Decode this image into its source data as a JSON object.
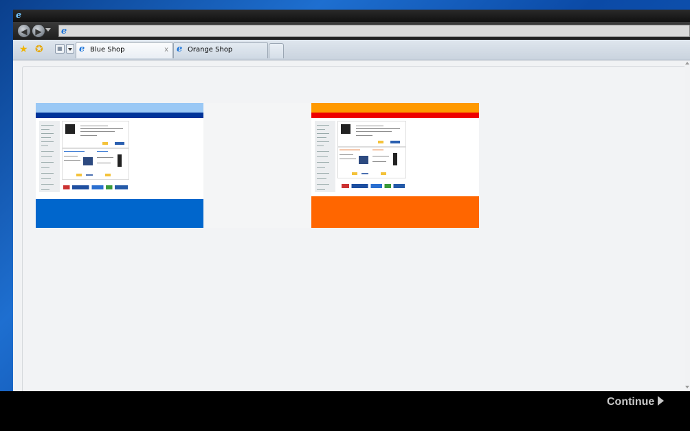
{
  "browser": {
    "title": "",
    "address": "",
    "icons": {
      "app": "internet-explorer-icon",
      "back": "back-arrow-icon",
      "forward": "forward-arrow-icon",
      "favorites": "star-icon",
      "add_favorite": "add-favorite-icon",
      "quick_tabs": "quick-tabs-icon"
    }
  },
  "tabs": [
    {
      "label": "Blue Shop",
      "active": true,
      "close": "x"
    },
    {
      "label": "Orange Shop",
      "active": false
    }
  ],
  "thumbnails": [
    {
      "name": "blue-shop-thumbnail",
      "header_color": "#9ac8f5",
      "bar_color": "#003399",
      "footer_color": "#0066cc"
    },
    {
      "name": "orange-shop-thumbnail",
      "header_color": "#ff9900",
      "bar_color": "#ee0000",
      "footer_color": "#ff6600"
    }
  ],
  "footer": {
    "continue_label": "Continue"
  },
  "colors": {
    "desktop": "#1a5fc4",
    "frame": "#1a1a1a",
    "content_bg": "#f1f2f4"
  }
}
